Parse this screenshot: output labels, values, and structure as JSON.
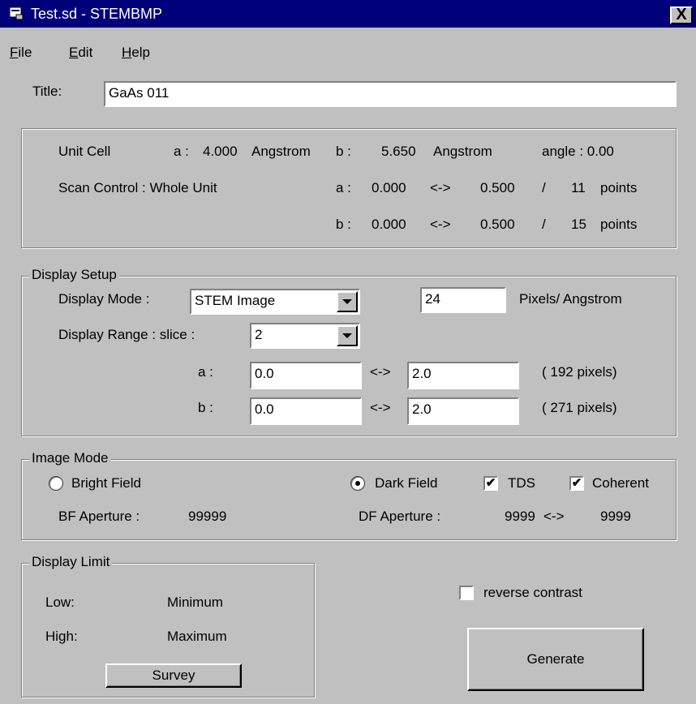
{
  "window": {
    "title": "Test.sd - STEMBMP",
    "close_label": "X"
  },
  "menu": [
    {
      "key": "F",
      "rest": "ile"
    },
    {
      "key": "E",
      "rest": "dit"
    },
    {
      "key": "H",
      "rest": "elp"
    }
  ],
  "title_field": {
    "label": "Title:",
    "value": "GaAs 011"
  },
  "unit_cell": {
    "label": "Unit Cell",
    "a_label": "a :",
    "a_value": "4.000",
    "a_unit": "Angstrom",
    "b_label": "b :",
    "b_value": "5.650",
    "b_unit": "Angstrom",
    "angle_label": "angle : 0.00"
  },
  "scan_control": {
    "label": "Scan Control  : Whole Unit",
    "a_label": "a :",
    "a_from": "0.000",
    "a_arrow": "<->",
    "a_to": "0.500",
    "a_sep": "/",
    "a_points": "11",
    "a_points_unit": "points",
    "b_label": "b :",
    "b_from": "0.000",
    "b_arrow": "<->",
    "b_to": "0.500",
    "b_sep": "/",
    "b_points": "15",
    "b_points_unit": "points"
  },
  "display_setup": {
    "legend": "Display Setup",
    "mode_label": "Display Mode :",
    "mode_value": "STEM Image",
    "pixels_value": "24",
    "pixels_unit": "Pixels/ Angstrom",
    "range_label": "Display Range :  slice :",
    "slice_value": "2",
    "a_label": "a :",
    "a_from": "0.0",
    "a_arrow": "<->",
    "a_to": "2.0",
    "a_pixels": "( 192 pixels)",
    "b_label": "b :",
    "b_from": "0.0",
    "b_arrow": "<->",
    "b_to": "2.0",
    "b_pixels": "( 271 pixels)"
  },
  "image_mode": {
    "legend": "Image Mode",
    "bright_field": "Bright Field",
    "dark_field": "Dark Field",
    "tds": "TDS",
    "coherent": "Coherent",
    "bf_aperture_label": "BF Aperture :",
    "bf_aperture_value": "99999",
    "df_aperture_label": "DF Aperture :",
    "df_from": "9999",
    "df_arrow": "<->",
    "df_to": "9999",
    "selected": "dark_field",
    "tds_checked": true,
    "coherent_checked": true
  },
  "display_limit": {
    "legend": "Display Limit",
    "low_label": "Low:",
    "low_value": "Minimum",
    "high_label": "High:",
    "high_value": "Maximum",
    "survey_label": "Survey"
  },
  "reverse_contrast": {
    "label": "reverse contrast",
    "checked": false
  },
  "generate_label": "Generate",
  "colors": {
    "titlebar": "#00007b",
    "face": "#c0c0c0"
  },
  "icons": {
    "app": "app-icon",
    "close": "close-icon",
    "dropdown": "chevron-down-icon"
  }
}
